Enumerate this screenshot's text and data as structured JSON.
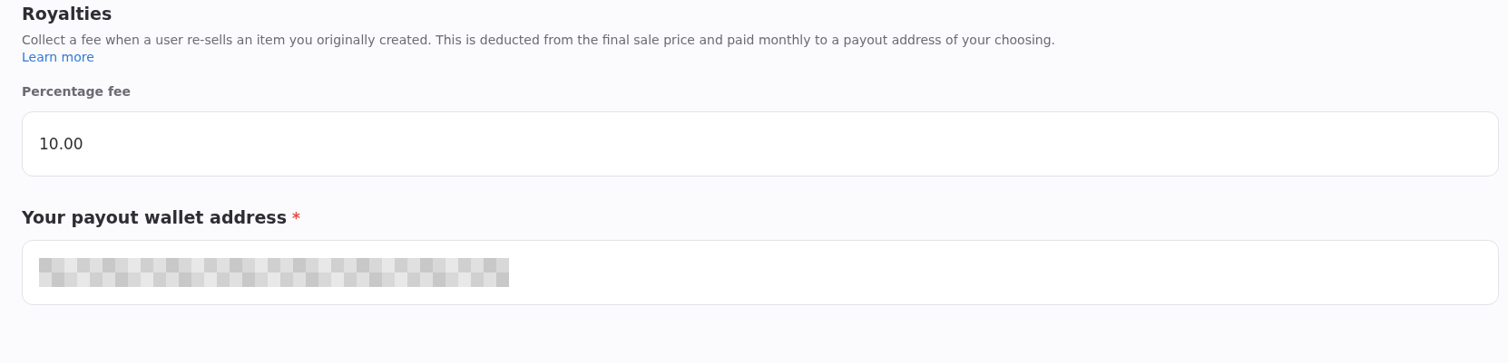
{
  "section": {
    "title": "Royalties",
    "description": "Collect a fee when a user re-sells an item you originally created. This is deducted from the final sale price and paid monthly to a payout address of your choosing.",
    "link": "Learn more"
  },
  "fee_field": {
    "label": "Percentage fee",
    "value": "10.00"
  },
  "payout_field": {
    "label": "Your payout wallet address",
    "required_mark": "*",
    "value_redacted": true
  }
}
